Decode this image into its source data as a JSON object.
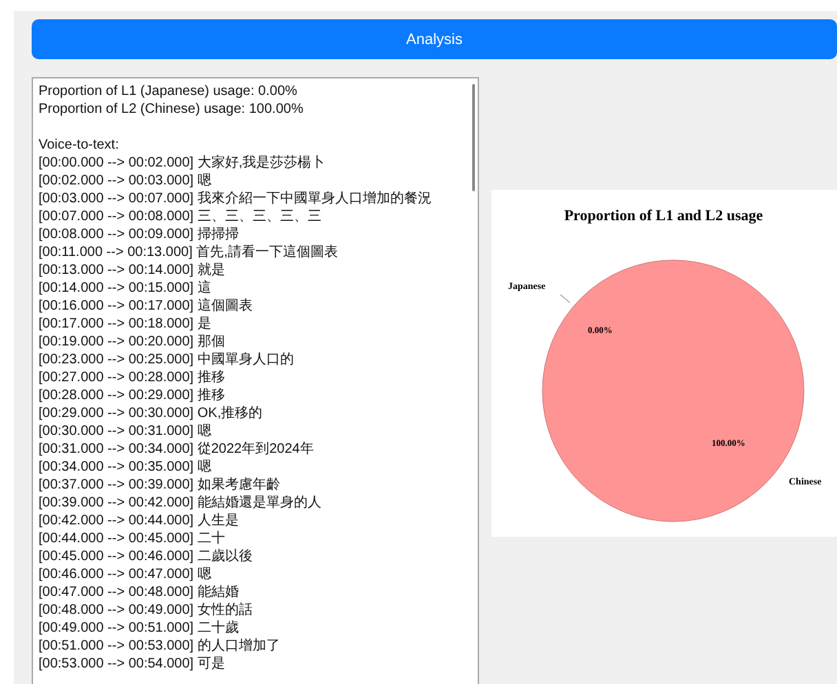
{
  "analysis_button": {
    "label": "Analysis"
  },
  "results": {
    "summary": [
      "Proportion of L1 (Japanese) usage: 0.00%",
      "Proportion of L2 (Chinese) usage: 100.00%"
    ],
    "transcript_heading": "Voice-to-text:",
    "transcript": [
      "[00:00.000 --> 00:02.000] 大家好,我是莎莎楊卜",
      "[00:02.000 --> 00:03.000] 嗯",
      "[00:03.000 --> 00:07.000] 我來介紹一下中國單身人口增加的餐況",
      "[00:07.000 --> 00:08.000] 三、三、三、三、三",
      "[00:08.000 --> 00:09.000] 掃掃掃",
      "[00:11.000 --> 00:13.000] 首先,請看一下這個圖表",
      "[00:13.000 --> 00:14.000] 就是",
      "[00:14.000 --> 00:15.000] 這",
      "[00:16.000 --> 00:17.000] 這個圖表",
      "[00:17.000 --> 00:18.000] 是",
      "[00:19.000 --> 00:20.000] 那個",
      "[00:23.000 --> 00:25.000] 中國單身人口的",
      "[00:27.000 --> 00:28.000] 推移",
      "[00:28.000 --> 00:29.000] 推移",
      "[00:29.000 --> 00:30.000] OK,推移的",
      "[00:30.000 --> 00:31.000] 嗯",
      "[00:31.000 --> 00:34.000] 從2022年到2024年",
      "[00:34.000 --> 00:35.000] 嗯",
      "[00:37.000 --> 00:39.000] 如果考慮年齡",
      "[00:39.000 --> 00:42.000] 能結婚還是單身的人",
      "[00:42.000 --> 00:44.000] 人生是",
      "[00:44.000 --> 00:45.000] 二十",
      "[00:45.000 --> 00:46.000] 二歲以後",
      "[00:46.000 --> 00:47.000] 嗯",
      "[00:47.000 --> 00:48.000] 能結婚",
      "[00:48.000 --> 00:49.000] 女性的話",
      "[00:49.000 --> 00:51.000] 二十歲",
      "[00:51.000 --> 00:53.000] 的人口增加了",
      "[00:53.000 --> 00:54.000] 可是"
    ]
  },
  "chart": {
    "chart_data": {
      "type": "pie",
      "title": "Proportion of L1 and L2 usage",
      "categories": [
        "Japanese",
        "Chinese"
      ],
      "values": [
        0,
        100
      ],
      "value_labels": [
        "0.00%",
        "100.00%"
      ],
      "color": "#ff9494"
    }
  }
}
